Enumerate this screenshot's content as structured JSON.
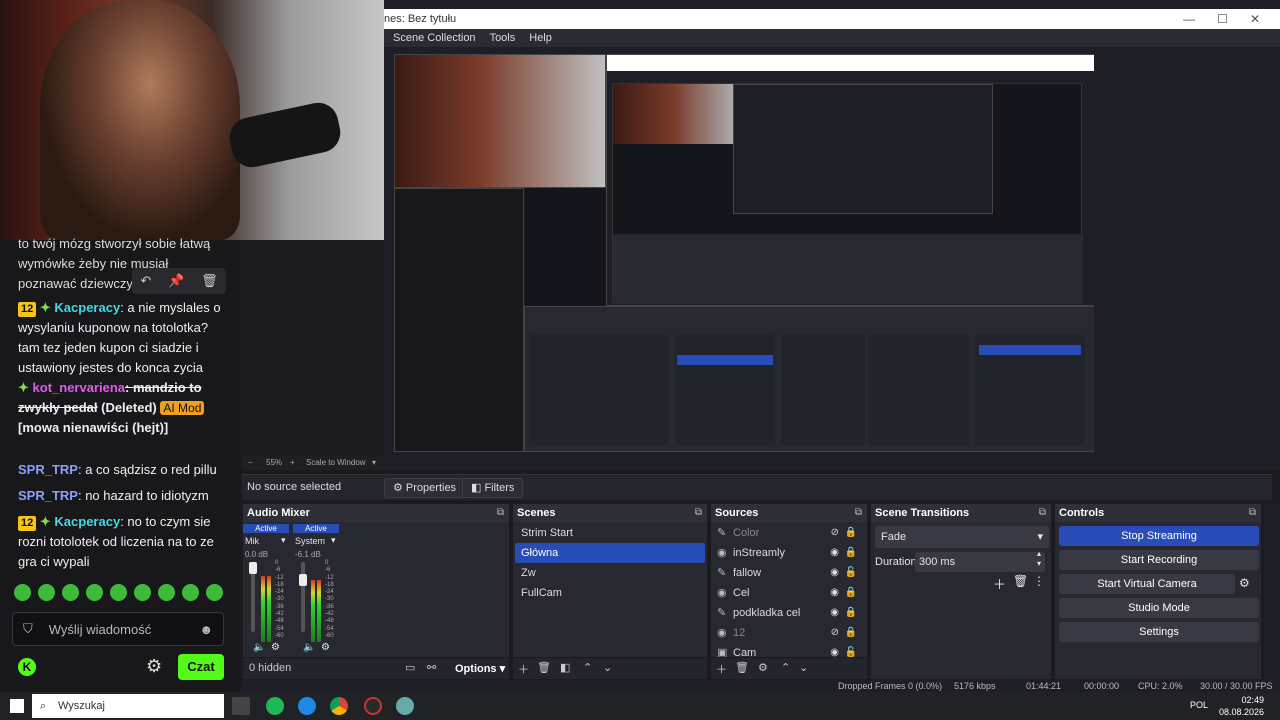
{
  "chat": {
    "partial_message": "to twój mózg stworzył sobie łatwą wymówke żeby nie musiał poznawać dziewczyn",
    "messages": [
      {
        "badge": "12",
        "user": "Kacperacy",
        "text": ": a nie myslales o wysylaniu kuponow na totolotka? tam tez jeden kupon ci siadzie i ustawiony jestes do konca zycia"
      },
      {
        "user": "kot_nervariena",
        "struck": ": mandzio to zwykły pedał",
        "deleted": "(Deleted)",
        "mod_badge": "AI Mod",
        "reason": "[mowa nienawiści (hejt)]"
      },
      {
        "user": "SPR_TRP",
        "text": ": a co sądzisz o red pillu"
      },
      {
        "user": "SPR_TRP",
        "text": ": no hazard to idiotyzm"
      },
      {
        "badge": "12",
        "user": "Kacperacy",
        "text": ": no to czym sie rozni totolotek od liczenia na to ze gra ci wypali"
      }
    ],
    "input_placeholder": "Wyślij wiadomość",
    "send_label": "Czat",
    "tools": [
      "↶",
      "📌",
      "🗑"
    ]
  },
  "obs": {
    "window_title": "nes: Bez tytułu",
    "menu": [
      "Scene Collection",
      "Tools",
      "Help"
    ],
    "preview_zoom": "55%",
    "preview_mode": "Scale to Window",
    "no_source": "No source selected",
    "properties_label": "Properties",
    "filters_label": "Filters",
    "audio_mixer": {
      "title": "Audio Mixer",
      "channels": [
        {
          "name": "Mik",
          "status": "Active",
          "db": "0.0 dB",
          "level": 0.82
        },
        {
          "name": "System",
          "status": "Active",
          "db": "-6.1 dB",
          "level": 0.78
        }
      ],
      "scale": [
        "0",
        "-6",
        "-12",
        "-18",
        "-24",
        "-30",
        "-36",
        "-42",
        "-48",
        "-54",
        "-60"
      ],
      "hidden_count": "0 hidden",
      "options_label": "Options"
    },
    "scenes": {
      "title": "Scenes",
      "items": [
        "Strim Start",
        "Główna",
        "Zw",
        "FullCam"
      ],
      "selected": 1
    },
    "sources": {
      "title": "Sources",
      "items": [
        {
          "name": "Color",
          "icon": "brush-icon",
          "visible": false,
          "locked": true
        },
        {
          "name": "inStreamly",
          "icon": "globe-icon",
          "visible": true,
          "locked": true
        },
        {
          "name": "fallow",
          "icon": "brush-icon",
          "visible": true,
          "locked": false
        },
        {
          "name": "Cel",
          "icon": "globe-icon",
          "visible": true,
          "locked": true
        },
        {
          "name": "podkladka cel",
          "icon": "brush-icon",
          "visible": true,
          "locked": true
        },
        {
          "name": "12",
          "icon": "globe-icon",
          "visible": false,
          "locked": true
        },
        {
          "name": "Cam",
          "icon": "camera-icon",
          "visible": true,
          "locked": false
        }
      ]
    },
    "transitions": {
      "title": "Scene Transitions",
      "selected": "Fade",
      "duration_label": "Duration",
      "duration_value": "300 ms"
    },
    "controls": {
      "title": "Controls",
      "buttons": [
        "Stop Streaming",
        "Start Recording",
        "Start Virtual Camera",
        "Studio Mode",
        "Settings"
      ]
    },
    "status": {
      "dropped": "Dropped Frames 0 (0.0%)",
      "bitrate": "5176 kbps",
      "live_time": "01:44:21",
      "rec_time": "00:00:00",
      "cpu": "CPU: 2.0%",
      "fps": "30.00 / 30.00 FPS"
    }
  },
  "taskbar": {
    "search_placeholder": "Wyszukaj",
    "lang": "POL",
    "time": "02:49",
    "date": "08.08.2026"
  },
  "colors": {
    "accent_blue": "#284cb8",
    "kick_green": "#53fc18",
    "chat_bg": "#18181b"
  }
}
